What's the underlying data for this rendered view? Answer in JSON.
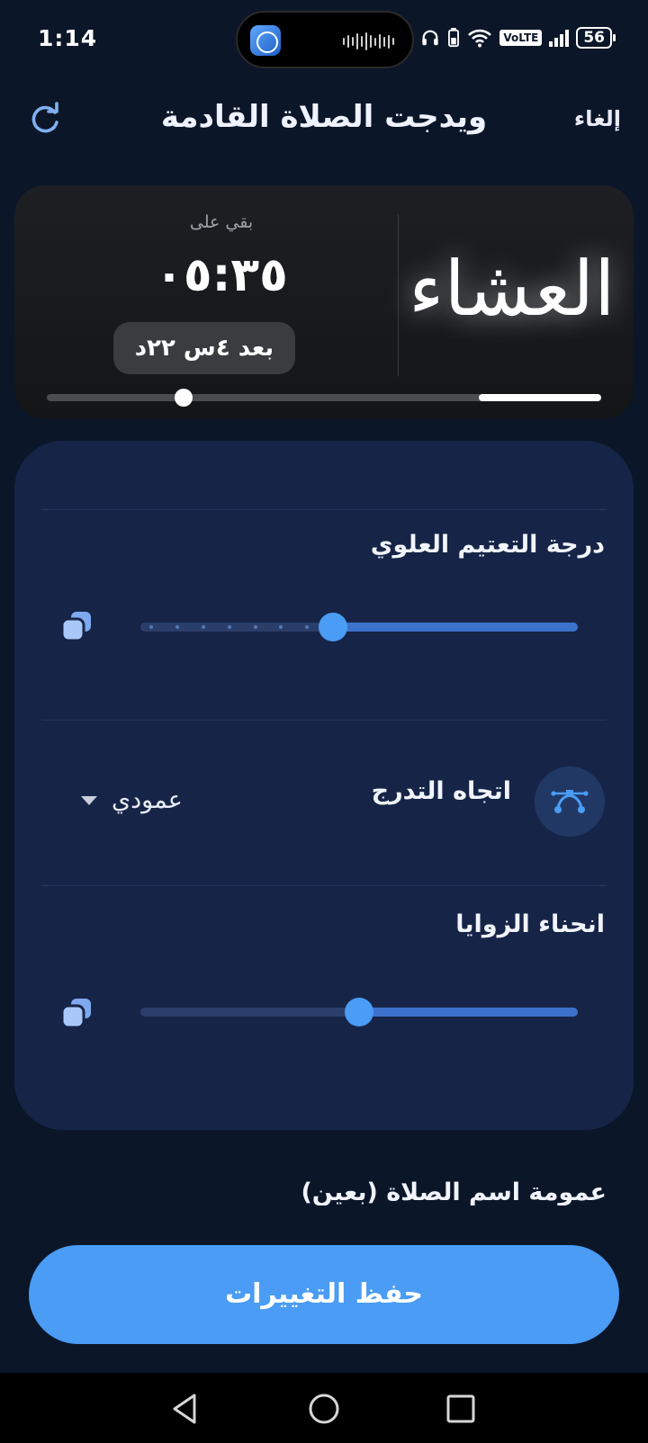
{
  "status_bar": {
    "time": "1:14",
    "battery": "56",
    "network_badge": "VoLTE",
    "icons": [
      "headphones-icon",
      "battery-saver-icon",
      "wifi-icon",
      "volte-icon",
      "signal-icon",
      "battery-icon"
    ]
  },
  "header": {
    "title": "ويدجت الصلاة القادمة",
    "cancel": "إلغاء",
    "refresh_icon": "refresh-icon"
  },
  "preview": {
    "prayer_name": "العشاء",
    "remaining_label": "بقي على",
    "countdown": "٠٥:٣٥",
    "after": "بعد ٤س ٢٢د",
    "progress_fraction": 0.78,
    "background_color": "#1a1b1e"
  },
  "settings": {
    "top_dimming": {
      "label": "درجة التعتيم العلوي",
      "value_fraction": 0.56
    },
    "gradient_direction": {
      "label": "اتجاه التدرج",
      "value": "عمودي",
      "icon": "bezier-curve-icon"
    },
    "corner_radius": {
      "label": "انحناء الزوايا",
      "value_fraction": 0.5
    }
  },
  "partial_row": {
    "label": "عمومة اسم الصلاة (بعين)"
  },
  "save_button": {
    "label": "حفظ التغييرات"
  },
  "colors": {
    "background": "#0c1629",
    "panel": "#162547",
    "accent": "#4a9cf5"
  },
  "navbar": {
    "icons": [
      "back-icon",
      "home-icon",
      "recents-icon"
    ]
  }
}
